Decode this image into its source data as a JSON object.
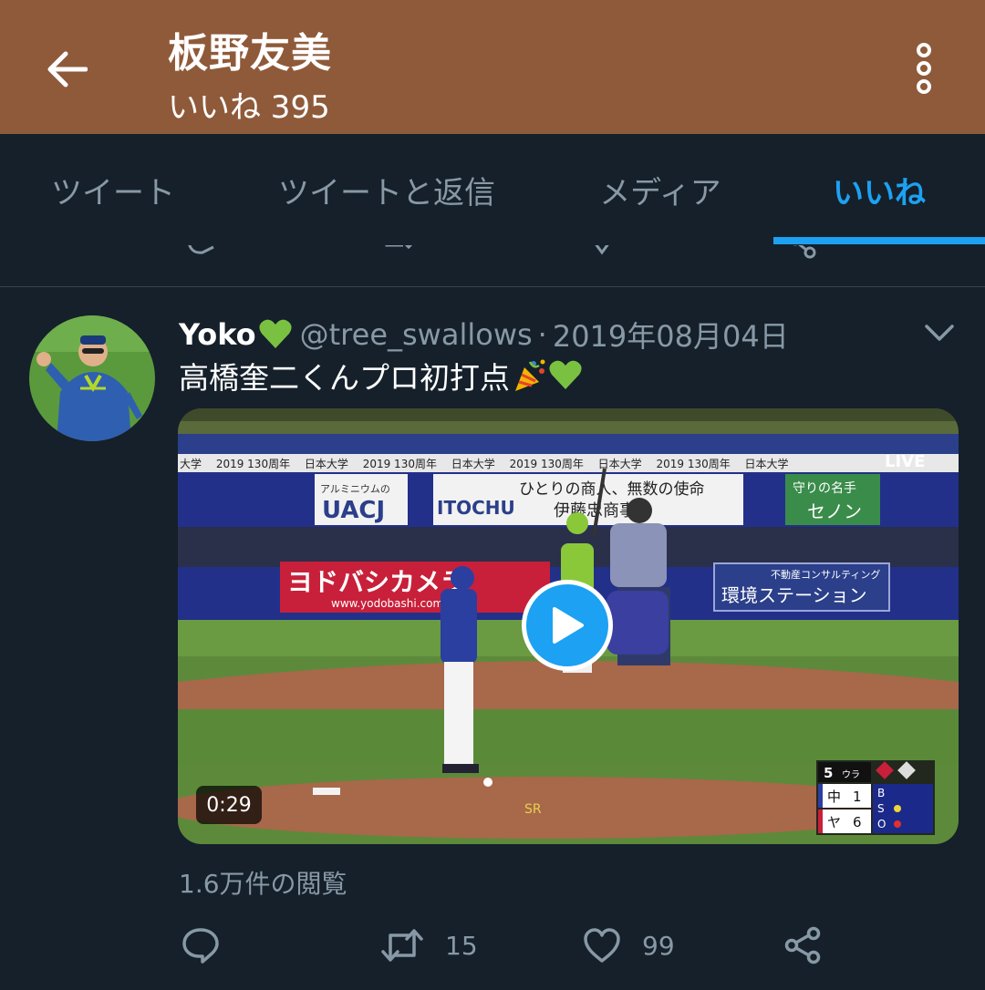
{
  "appbar": {
    "title": "板野友美",
    "subtitle": "いいね 395",
    "back_icon": "arrow-left-icon",
    "menu_icon": "more-vertical-icon",
    "background": "#8f5a3a"
  },
  "tabs": [
    {
      "label": "ツイート",
      "active": false
    },
    {
      "label": "ツイートと返信",
      "active": false
    },
    {
      "label": "メディア",
      "active": false
    },
    {
      "label": "いいね",
      "active": true
    }
  ],
  "accent": "#1da1f2",
  "tweet": {
    "name": "Yoko",
    "handle": "@tree_swallows",
    "separator": "·",
    "date": "2019年08月04日",
    "text": "高橋奎二くんプロ初打点",
    "media": {
      "duration": "0:29",
      "live_badge": "LIVE",
      "score": {
        "inning": "5",
        "half": "ウラ",
        "team1": "中",
        "score1": "1",
        "team2": "ヤ",
        "score2": "6"
      }
    },
    "views": "1.6万件の閲覧",
    "actions": {
      "reply": {
        "icon": "reply-icon",
        "count": ""
      },
      "retweet": {
        "icon": "retweet-icon",
        "count": "15"
      },
      "like": {
        "icon": "heart-icon",
        "count": "99"
      },
      "share": {
        "icon": "share-icon",
        "count": ""
      }
    }
  }
}
